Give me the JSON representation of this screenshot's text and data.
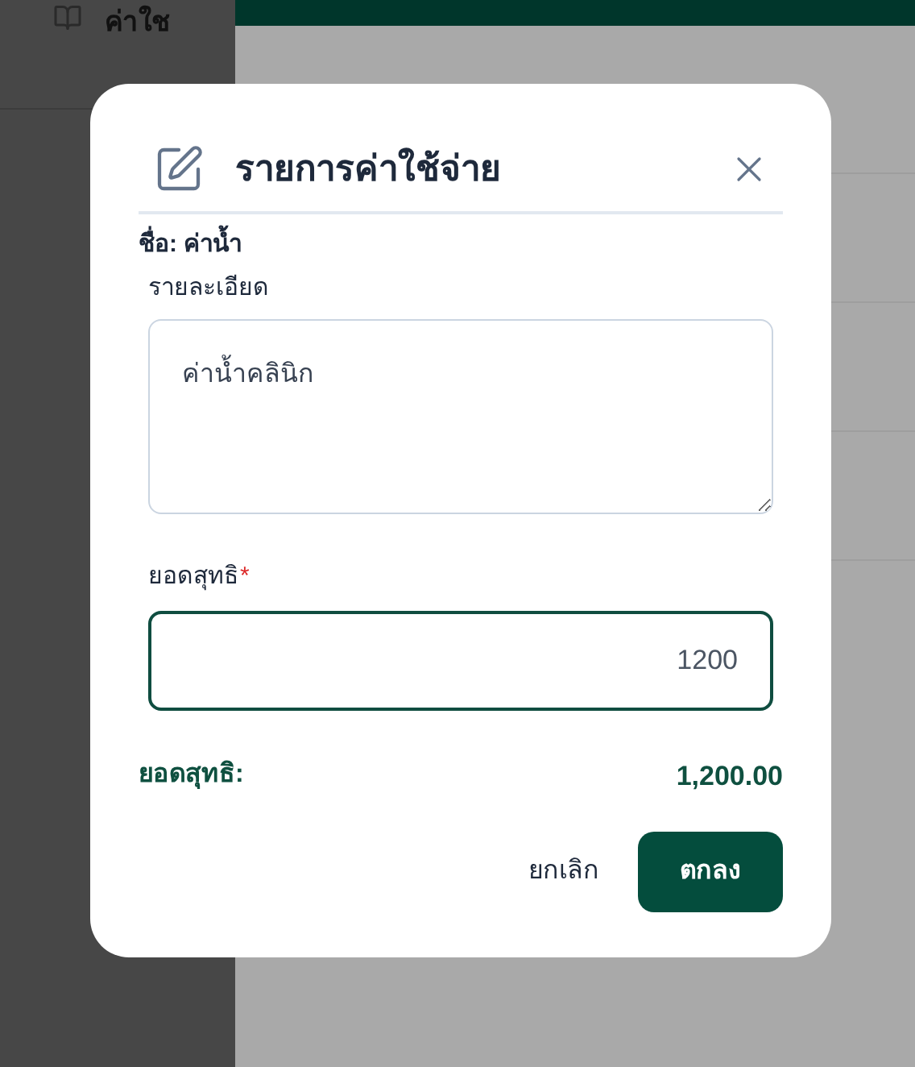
{
  "background": {
    "sidebar_title": "ค่าใช"
  },
  "dialog": {
    "title": "รายการค่าใช้จ่าย",
    "name_line": "ชื่อ: ค่าน้ำ",
    "detail_field": {
      "label": "รายละเอียด",
      "value": "ค่าน้ำคลินิก"
    },
    "amount_field": {
      "label": "ยอดสุทธิ",
      "required": true,
      "required_mark": "*",
      "value": "1200"
    },
    "summary": {
      "label": "ยอดสุทธิ:",
      "value": "1,200.00"
    },
    "buttons": [
      {
        "label": "ยกเลิก",
        "kind": "text"
      },
      {
        "label": "ตกลง",
        "kind": "primary"
      }
    ]
  }
}
